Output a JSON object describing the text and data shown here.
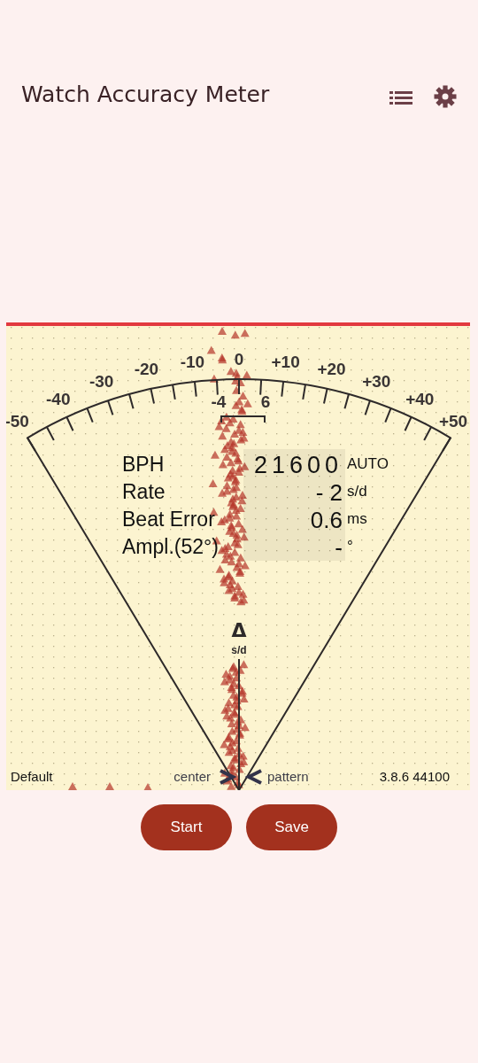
{
  "app_bar": {
    "title": "Watch Accuracy Meter"
  },
  "meter": {
    "scale_labels": [
      "-50",
      "-40",
      "-30",
      "-20",
      "-10",
      "0",
      "+10",
      "+20",
      "+30",
      "+40",
      "+50"
    ],
    "bracket_labels": [
      "-4",
      "6"
    ],
    "readings": [
      {
        "label": "BPH",
        "value": "21600",
        "unit": "AUTO"
      },
      {
        "label": "Rate",
        "value": "- 2",
        "unit": "s/d"
      },
      {
        "label": "Beat Error",
        "value": "0.6",
        "unit": "ms"
      },
      {
        "label": "Ampl.(52°)",
        "value": "-",
        "unit": "°"
      }
    ],
    "delta_symbol": "Δ",
    "delta_unit": "s/d",
    "profile": "Default",
    "center_label": "center",
    "pattern_label": "pattern",
    "version": "3.8.6 44100"
  },
  "buttons": [
    "Start",
    "Save"
  ]
}
